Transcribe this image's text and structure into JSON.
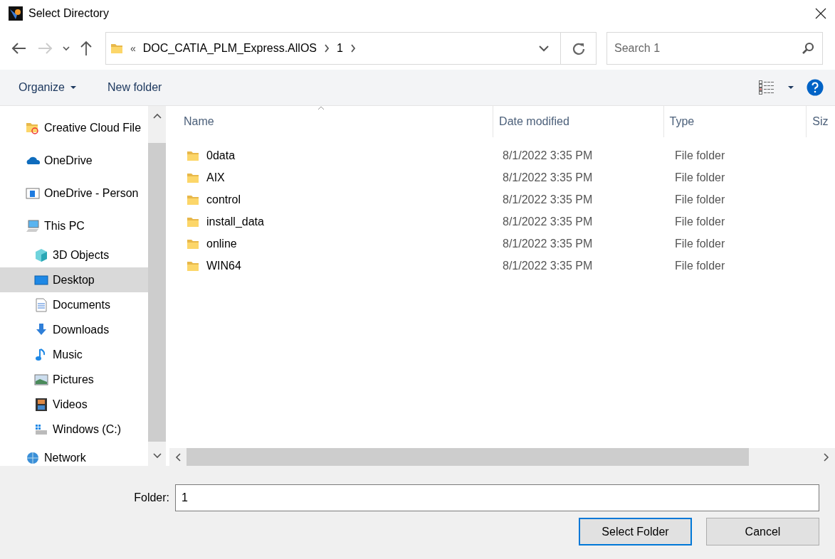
{
  "window": {
    "title": "Select Directory"
  },
  "address": {
    "overflow": "«",
    "crumbs": [
      "DOC_CATIA_PLM_Express.AllOS",
      "1"
    ]
  },
  "search": {
    "placeholder": "Search 1"
  },
  "toolbar": {
    "organize": "Organize",
    "new_folder": "New folder"
  },
  "sidebar": {
    "items": [
      {
        "label": "Creative Cloud File",
        "selected": false
      },
      {
        "label": "OneDrive",
        "selected": false
      },
      {
        "label": "OneDrive - Person",
        "selected": false
      },
      {
        "label": "This PC",
        "selected": false,
        "children": [
          {
            "label": "3D Objects",
            "selected": false
          },
          {
            "label": "Desktop",
            "selected": true
          },
          {
            "label": "Documents",
            "selected": false
          },
          {
            "label": "Downloads",
            "selected": false
          },
          {
            "label": "Music",
            "selected": false
          },
          {
            "label": "Pictures",
            "selected": false
          },
          {
            "label": "Videos",
            "selected": false
          },
          {
            "label": "Windows (C:)",
            "selected": false
          }
        ]
      },
      {
        "label": "Network",
        "selected": false
      }
    ]
  },
  "table": {
    "columns": [
      "Name",
      "Date modified",
      "Type",
      "Siz"
    ],
    "rows": [
      {
        "name": "0data",
        "date": "8/1/2022 3:35 PM",
        "type": "File folder"
      },
      {
        "name": "AIX",
        "date": "8/1/2022 3:35 PM",
        "type": "File folder"
      },
      {
        "name": "control",
        "date": "8/1/2022 3:35 PM",
        "type": "File folder"
      },
      {
        "name": "install_data",
        "date": "8/1/2022 3:35 PM",
        "type": "File folder"
      },
      {
        "name": "online",
        "date": "8/1/2022 3:35 PM",
        "type": "File folder"
      },
      {
        "name": "WIN64",
        "date": "8/1/2022 3:35 PM",
        "type": "File folder"
      }
    ]
  },
  "footer": {
    "label": "Folder:",
    "value": "1",
    "buttons": [
      {
        "label": "Select Folder",
        "default": true
      },
      {
        "label": "Cancel",
        "default": false
      }
    ]
  }
}
